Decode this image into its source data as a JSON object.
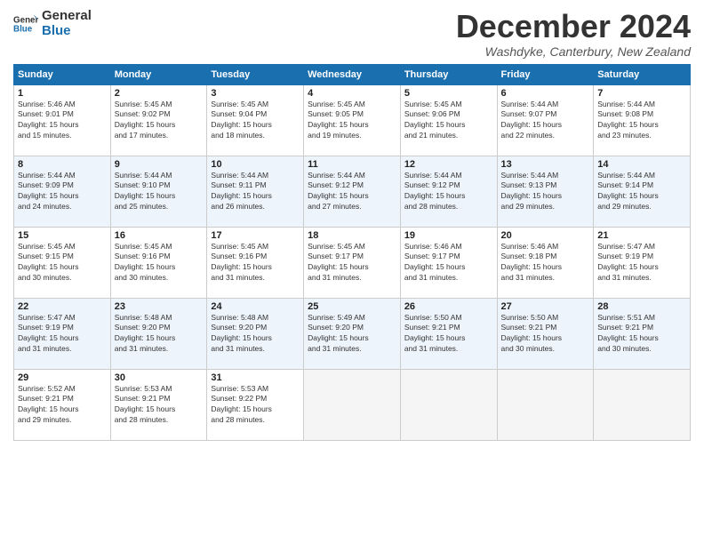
{
  "logo": {
    "line1": "General",
    "line2": "Blue"
  },
  "title": "December 2024",
  "subtitle": "Washdyke, Canterbury, New Zealand",
  "days_of_week": [
    "Sunday",
    "Monday",
    "Tuesday",
    "Wednesday",
    "Thursday",
    "Friday",
    "Saturday"
  ],
  "weeks": [
    [
      {
        "day": "1",
        "sunrise": "5:46 AM",
        "sunset": "9:01 PM",
        "daylight": "15 hours and 15 minutes."
      },
      {
        "day": "2",
        "sunrise": "5:45 AM",
        "sunset": "9:02 PM",
        "daylight": "15 hours and 17 minutes."
      },
      {
        "day": "3",
        "sunrise": "5:45 AM",
        "sunset": "9:04 PM",
        "daylight": "15 hours and 18 minutes."
      },
      {
        "day": "4",
        "sunrise": "5:45 AM",
        "sunset": "9:05 PM",
        "daylight": "15 hours and 19 minutes."
      },
      {
        "day": "5",
        "sunrise": "5:45 AM",
        "sunset": "9:06 PM",
        "daylight": "15 hours and 21 minutes."
      },
      {
        "day": "6",
        "sunrise": "5:44 AM",
        "sunset": "9:07 PM",
        "daylight": "15 hours and 22 minutes."
      },
      {
        "day": "7",
        "sunrise": "5:44 AM",
        "sunset": "9:08 PM",
        "daylight": "15 hours and 23 minutes."
      }
    ],
    [
      {
        "day": "8",
        "sunrise": "5:44 AM",
        "sunset": "9:09 PM",
        "daylight": "15 hours and 24 minutes."
      },
      {
        "day": "9",
        "sunrise": "5:44 AM",
        "sunset": "9:10 PM",
        "daylight": "15 hours and 25 minutes."
      },
      {
        "day": "10",
        "sunrise": "5:44 AM",
        "sunset": "9:11 PM",
        "daylight": "15 hours and 26 minutes."
      },
      {
        "day": "11",
        "sunrise": "5:44 AM",
        "sunset": "9:12 PM",
        "daylight": "15 hours and 27 minutes."
      },
      {
        "day": "12",
        "sunrise": "5:44 AM",
        "sunset": "9:12 PM",
        "daylight": "15 hours and 28 minutes."
      },
      {
        "day": "13",
        "sunrise": "5:44 AM",
        "sunset": "9:13 PM",
        "daylight": "15 hours and 29 minutes."
      },
      {
        "day": "14",
        "sunrise": "5:44 AM",
        "sunset": "9:14 PM",
        "daylight": "15 hours and 29 minutes."
      }
    ],
    [
      {
        "day": "15",
        "sunrise": "5:45 AM",
        "sunset": "9:15 PM",
        "daylight": "15 hours and 30 minutes."
      },
      {
        "day": "16",
        "sunrise": "5:45 AM",
        "sunset": "9:16 PM",
        "daylight": "15 hours and 30 minutes."
      },
      {
        "day": "17",
        "sunrise": "5:45 AM",
        "sunset": "9:16 PM",
        "daylight": "15 hours and 31 minutes."
      },
      {
        "day": "18",
        "sunrise": "5:45 AM",
        "sunset": "9:17 PM",
        "daylight": "15 hours and 31 minutes."
      },
      {
        "day": "19",
        "sunrise": "5:46 AM",
        "sunset": "9:17 PM",
        "daylight": "15 hours and 31 minutes."
      },
      {
        "day": "20",
        "sunrise": "5:46 AM",
        "sunset": "9:18 PM",
        "daylight": "15 hours and 31 minutes."
      },
      {
        "day": "21",
        "sunrise": "5:47 AM",
        "sunset": "9:19 PM",
        "daylight": "15 hours and 31 minutes."
      }
    ],
    [
      {
        "day": "22",
        "sunrise": "5:47 AM",
        "sunset": "9:19 PM",
        "daylight": "15 hours and 31 minutes."
      },
      {
        "day": "23",
        "sunrise": "5:48 AM",
        "sunset": "9:20 PM",
        "daylight": "15 hours and 31 minutes."
      },
      {
        "day": "24",
        "sunrise": "5:48 AM",
        "sunset": "9:20 PM",
        "daylight": "15 hours and 31 minutes."
      },
      {
        "day": "25",
        "sunrise": "5:49 AM",
        "sunset": "9:20 PM",
        "daylight": "15 hours and 31 minutes."
      },
      {
        "day": "26",
        "sunrise": "5:50 AM",
        "sunset": "9:21 PM",
        "daylight": "15 hours and 31 minutes."
      },
      {
        "day": "27",
        "sunrise": "5:50 AM",
        "sunset": "9:21 PM",
        "daylight": "15 hours and 30 minutes."
      },
      {
        "day": "28",
        "sunrise": "5:51 AM",
        "sunset": "9:21 PM",
        "daylight": "15 hours and 30 minutes."
      }
    ],
    [
      {
        "day": "29",
        "sunrise": "5:52 AM",
        "sunset": "9:21 PM",
        "daylight": "15 hours and 29 minutes."
      },
      {
        "day": "30",
        "sunrise": "5:53 AM",
        "sunset": "9:21 PM",
        "daylight": "15 hours and 28 minutes."
      },
      {
        "day": "31",
        "sunrise": "5:53 AM",
        "sunset": "9:22 PM",
        "daylight": "15 hours and 28 minutes."
      },
      null,
      null,
      null,
      null
    ]
  ],
  "labels": {
    "sunrise": "Sunrise:",
    "sunset": "Sunset:",
    "daylight": "Daylight:"
  }
}
